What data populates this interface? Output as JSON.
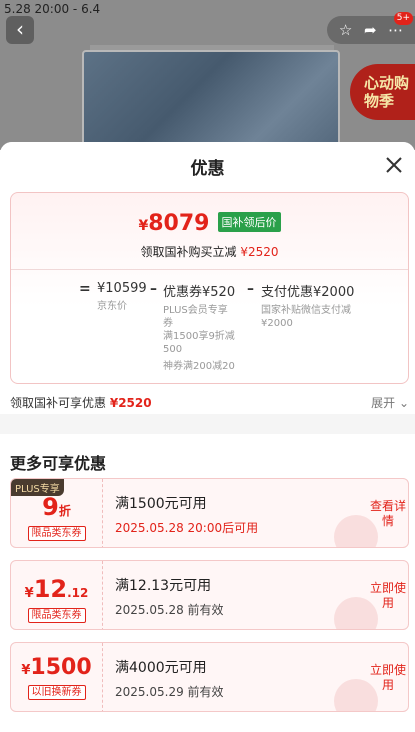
{
  "background": {
    "date_text": "5.28 20:00 - 6.4",
    "back_icon": "chevron-left-icon",
    "badge_text": "5+",
    "promo_text": "心动购物季"
  },
  "sheet": {
    "title": "优惠"
  },
  "price_card": {
    "yen": "¥",
    "price": "8079",
    "tag": "国补领后价",
    "subsidy_label": "领取国补购买立减",
    "subsidy_amount": "¥2520",
    "formula": {
      "eq": "=",
      "base": "¥10599",
      "base_label": "京东价",
      "minus1": "–",
      "coupon": "优惠券¥520",
      "coupon_desc1": "PLUS会员专享券",
      "coupon_desc2": "满1500享9折减500",
      "coupon_desc3": "神券满200减20",
      "minus2": "–",
      "pay": "支付优惠¥2000",
      "pay_desc": "国家补贴微信支付减¥2000"
    }
  },
  "claim_row": {
    "label": "领取国补可享优惠",
    "amount": "¥2520",
    "expand_label": "展开"
  },
  "more": {
    "title": "更多可享优惠",
    "coupons": [
      {
        "plus_tag": "PLUS专享",
        "value": "9",
        "value_unit": "折",
        "tag": "限品类东券",
        "title": "满1500元可用",
        "sub": "2025.05.28 20:00后可用",
        "button": "查看详情"
      },
      {
        "yen": "¥",
        "value": "12",
        "value_decimal": ".12",
        "tag": "限品类东券",
        "title": "满12.13元可用",
        "sub": "2025.05.28 前有效",
        "button": "立即使用"
      },
      {
        "yen": "¥",
        "value": "1500",
        "tag": "以旧换新券",
        "title": "满4000元可用",
        "sub": "2025.05.29 前有效",
        "button": "立即使用"
      }
    ]
  }
}
